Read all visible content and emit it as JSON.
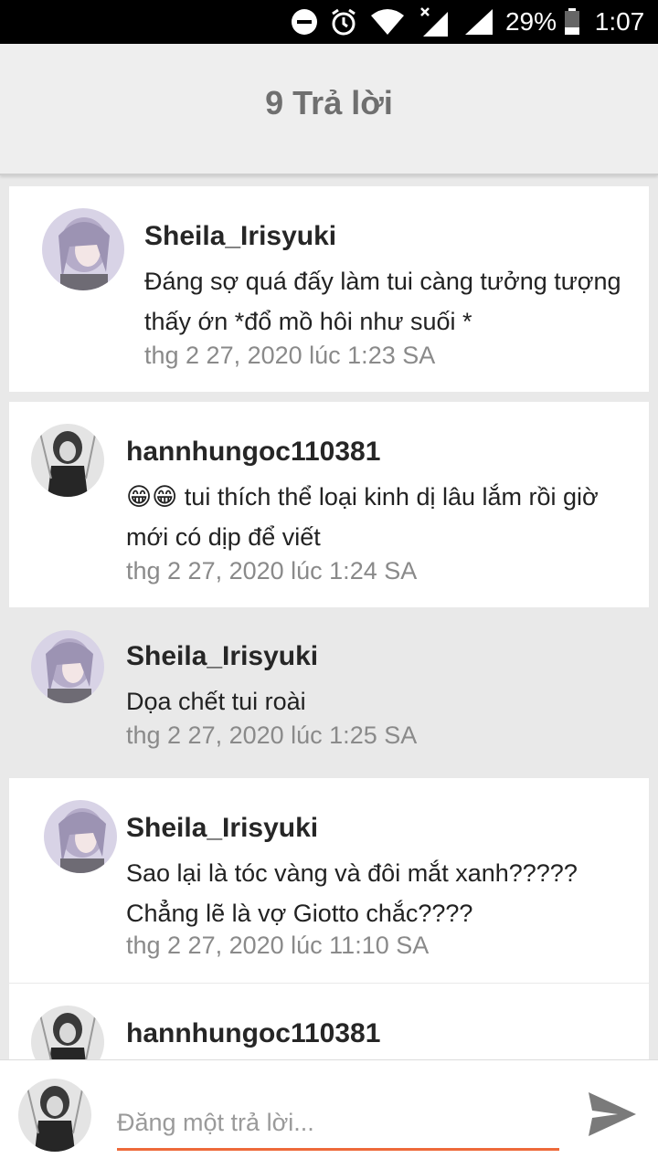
{
  "status_bar": {
    "battery_text": "29%",
    "time": "1:07",
    "icons": [
      "dnd-icon",
      "alarm-icon",
      "wifi-icon",
      "signal-x-icon",
      "signal-icon",
      "battery-icon"
    ]
  },
  "header": {
    "title": "9 Trả lời"
  },
  "comments": [
    {
      "author": "Sheila_Irisyuki",
      "text": "Đáng sợ quá đấy làm tui càng tưởng tượng thấy ớn *đổ mồ hôi như suối *",
      "time": "thg 2 27, 2020 lúc 1:23 SA"
    },
    {
      "author": "hannhungoc110381",
      "text": "😁😁 tui thích thể loại kinh dị lâu lắm rồi giờ mới có dịp để viết",
      "time": "thg 2 27, 2020 lúc 1:24 SA"
    },
    {
      "author": "Sheila_Irisyuki",
      "text": "Dọa chết tui roài",
      "time": "thg 2 27, 2020 lúc 1:25 SA"
    },
    {
      "author": "Sheila_Irisyuki",
      "text": "Sao lại là tóc vàng và đôi mắt xanh????? Chẳng lẽ là vợ Giotto chắc????",
      "time": "thg 2 27, 2020 lúc 11:10 SA"
    },
    {
      "author": "hannhungoc110381",
      "text": "",
      "time": ""
    }
  ],
  "reply": {
    "placeholder": "Đăng một trả lời..."
  },
  "colors": {
    "accent": "#ee6a3a",
    "header_bg": "#eeeeee",
    "list_bg": "#e9e9e9"
  }
}
